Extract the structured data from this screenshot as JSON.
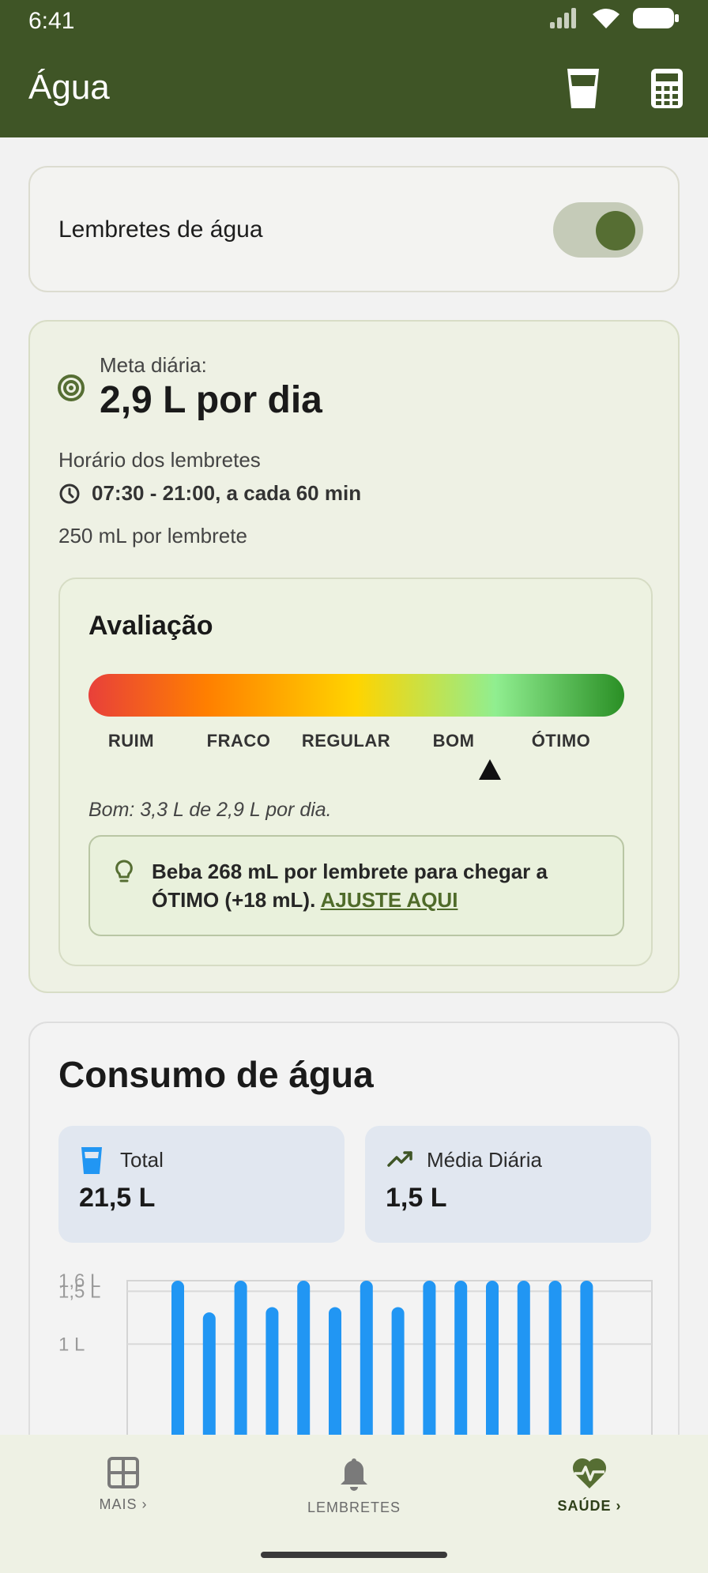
{
  "status_bar": {
    "time": "6:41",
    "icons": [
      "signal-icon",
      "wifi-icon",
      "battery-icon"
    ]
  },
  "app_bar": {
    "title": "Água",
    "actions": [
      "water-glass-icon",
      "calculator-icon"
    ]
  },
  "reminders": {
    "label": "Lembretes de água",
    "enabled": true
  },
  "goal": {
    "label": "Meta diária:",
    "value": "2,9 L por dia",
    "schedule_label": "Horário dos lembretes",
    "schedule_value": "07:30 - 21:00, a cada 60 min",
    "per_reminder": "250 mL por lembrete"
  },
  "evaluation": {
    "title": "Avaliação",
    "levels": [
      "RUIM",
      "FRACO",
      "REGULAR",
      "BOM",
      "ÓTIMO"
    ],
    "current_level": "BOM",
    "note": "Bom: 3,3 L de 2,9 L por dia.",
    "tip_text": "Beba 268 mL por lembrete para chegar a ÓTIMO (+18 mL).",
    "tip_link": "AJUSTE AQUI"
  },
  "consumption": {
    "title": "Consumo de água",
    "total_label": "Total",
    "total_value": "21,5 L",
    "average_label": "Média Diária",
    "average_value": "1,5 L"
  },
  "chart_data": {
    "type": "bar",
    "y_tick_labels": [
      "1,6 L",
      "1,5 L",
      "1 L"
    ],
    "values": [
      1.6,
      1.3,
      1.6,
      1.35,
      1.6,
      1.35,
      1.6,
      1.35,
      1.6,
      1.6,
      1.6,
      1.6,
      1.6,
      1.6,
      0.05
    ],
    "color": "#2196f3"
  },
  "bottom_nav": {
    "items": [
      {
        "label": "MAIS",
        "icon": "grid-icon"
      },
      {
        "label": "LEMBRETES",
        "icon": "bell-icon"
      },
      {
        "label": "SAÚDE",
        "icon": "heart-pulse-icon",
        "active": true
      }
    ]
  },
  "colors": {
    "primary": "#3f5526",
    "accent": "#566e33",
    "bar": "#2196f3"
  }
}
